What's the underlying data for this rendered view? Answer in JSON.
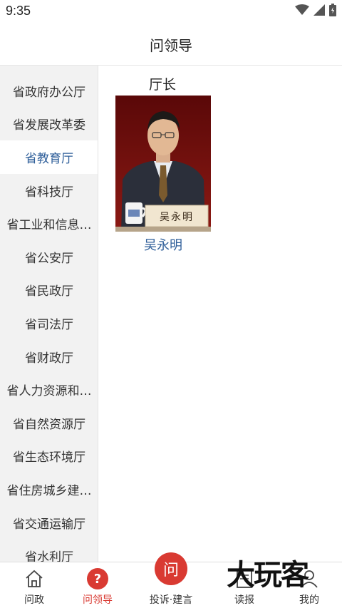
{
  "status_bar": {
    "time": "9:35",
    "icons": [
      "wifi-icon",
      "signal-icon",
      "battery-icon"
    ]
  },
  "header": {
    "title": "问领导"
  },
  "sidebar": {
    "items": [
      {
        "label": "省政府办公厅",
        "active": false
      },
      {
        "label": "省发展改革委",
        "active": false
      },
      {
        "label": "省教育厅",
        "active": true
      },
      {
        "label": "省科技厅",
        "active": false
      },
      {
        "label": "省工业和信息…",
        "active": false
      },
      {
        "label": "省公安厅",
        "active": false
      },
      {
        "label": "省民政厅",
        "active": false
      },
      {
        "label": "省司法厅",
        "active": false
      },
      {
        "label": "省财政厅",
        "active": false
      },
      {
        "label": "省人力资源和…",
        "active": false
      },
      {
        "label": "省自然资源厅",
        "active": false
      },
      {
        "label": "省生态环境厅",
        "active": false
      },
      {
        "label": "省住房城乡建…",
        "active": false
      },
      {
        "label": "省交通运输厅",
        "active": false
      },
      {
        "label": "省水利厅",
        "active": false
      }
    ]
  },
  "main": {
    "leader": {
      "title": "厅长",
      "name": "吴永明",
      "nameplate": "吴永明"
    }
  },
  "bottom_nav": {
    "items": [
      {
        "label": "问政",
        "icon": "home-icon",
        "active": false
      },
      {
        "label": "问领导",
        "icon": "question-icon",
        "active": true
      },
      {
        "label": "投诉·建言",
        "icon": "ask-icon",
        "icon_text": "问",
        "active": false
      },
      {
        "label": "读报",
        "icon": "newspaper-icon",
        "active": false
      },
      {
        "label": "我的",
        "icon": "user-icon",
        "active": false
      }
    ]
  },
  "watermark": {
    "text": "大玩客"
  },
  "colors": {
    "accent_blue": "#2f5f9a",
    "accent_red": "#d93a32",
    "sidebar_bg": "#f2f2f2"
  }
}
